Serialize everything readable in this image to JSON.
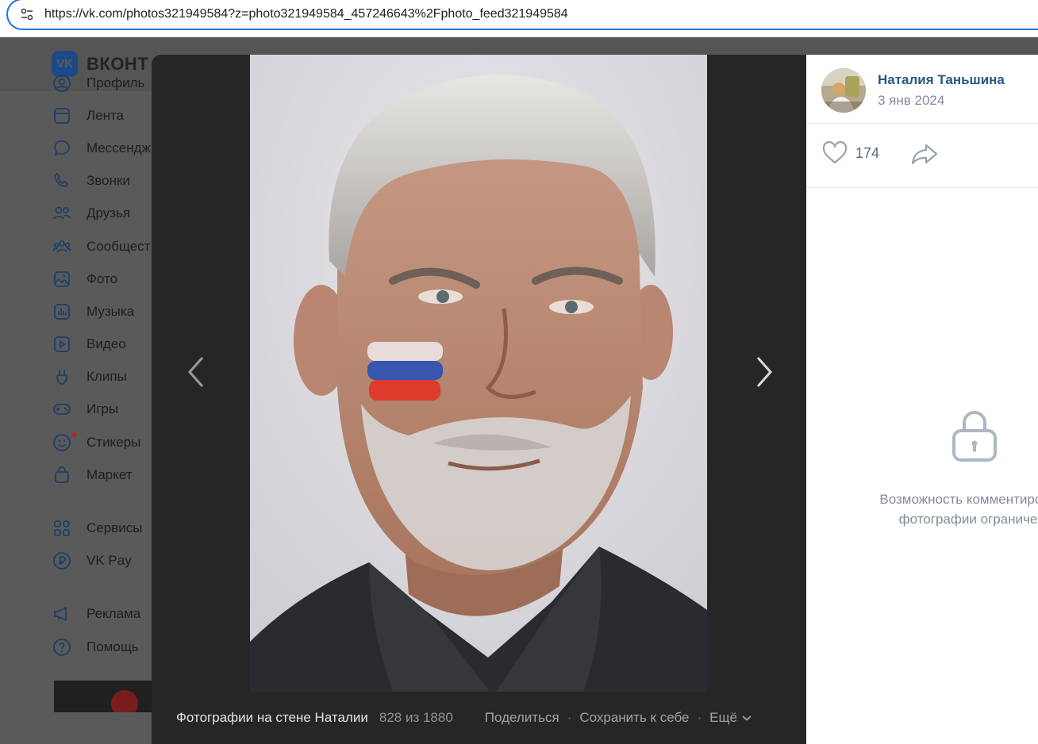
{
  "browser": {
    "url": "https://vk.com/photos321949584?z=photo321949584_457246643%2Fphoto_feed321949584",
    "site_info_icon": "tune-icon"
  },
  "header": {
    "logo_text": "ВКОНТ"
  },
  "sidebar": {
    "items": [
      {
        "label": "Профиль",
        "icon": "user-circle-icon"
      },
      {
        "label": "Лента",
        "icon": "newsfeed-icon"
      },
      {
        "label": "Мессендж",
        "icon": "message-icon"
      },
      {
        "label": "Звонки",
        "icon": "phone-icon"
      },
      {
        "label": "Друзья",
        "icon": "users-icon"
      },
      {
        "label": "Сообщест",
        "icon": "community-icon"
      },
      {
        "label": "Фото",
        "icon": "photo-icon"
      },
      {
        "label": "Музыка",
        "icon": "music-icon"
      },
      {
        "label": "Видео",
        "icon": "video-icon"
      },
      {
        "label": "Клипы",
        "icon": "clips-icon"
      },
      {
        "label": "Игры",
        "icon": "gamepad-icon"
      },
      {
        "label": "Стикеры",
        "icon": "sticker-icon"
      },
      {
        "label": "Маркет",
        "icon": "shopping-bag-icon"
      }
    ],
    "items2": [
      {
        "label": "Сервисы",
        "icon": "services-icon"
      },
      {
        "label": "VK Pay",
        "icon": "vkpay-icon"
      }
    ],
    "items3": [
      {
        "label": "Реклама",
        "icon": "megaphone-icon"
      },
      {
        "label": "Помощь",
        "icon": "help-icon"
      }
    ]
  },
  "viewer": {
    "album_title": "Фотографии на стене Наталии",
    "counter": "828 из 1880",
    "share_label": "Поделиться",
    "save_label": "Сохранить к себе",
    "more_label": "Ещё",
    "separator": "·"
  },
  "panel": {
    "author_name": "Наталия Таньшина",
    "date": "3 янв 2024",
    "likes": "174",
    "restricted_line1": "Возможность комментирова",
    "restricted_line2": "фотографии ограниче"
  },
  "colors": {
    "link": "#2a5885",
    "secondary": "#818c99",
    "viewer_bg": "#262626",
    "address_focus": "#1a73e8"
  }
}
